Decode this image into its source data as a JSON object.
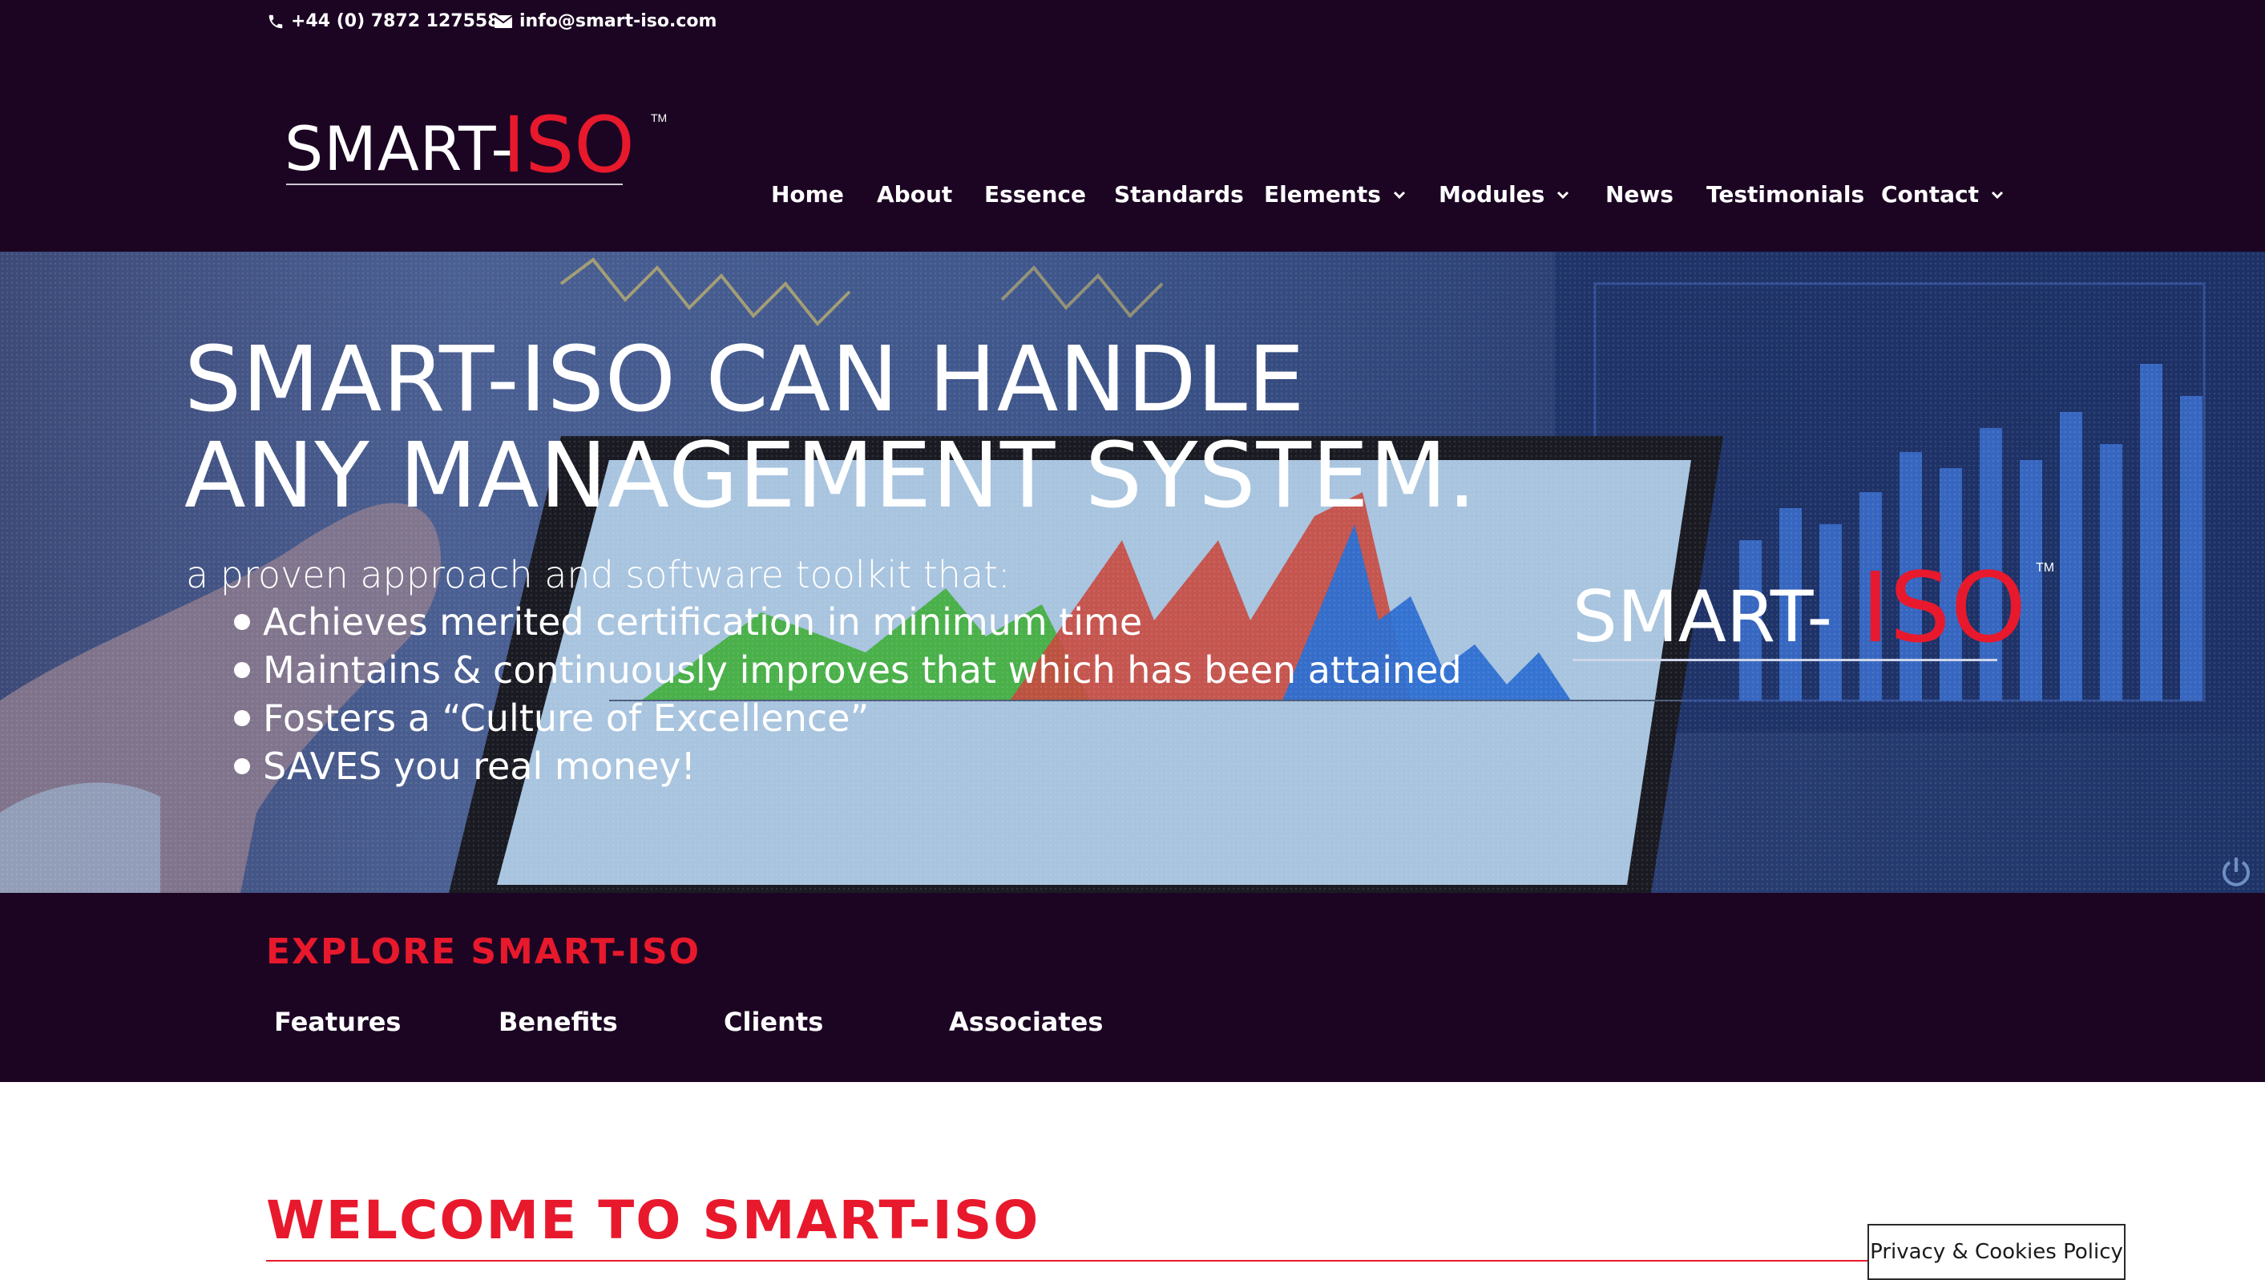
{
  "topbar": {
    "phone": "+44 (0) 7872 127558",
    "email": "info@smart-iso.com",
    "phone_icon": "phone-icon",
    "email_icon": "envelope-icon"
  },
  "logo": {
    "part1": "SMART-",
    "part2": "ISO",
    "tm": "TM"
  },
  "nav": {
    "items": [
      {
        "label": "Home",
        "dropdown": false
      },
      {
        "label": "About",
        "dropdown": false
      },
      {
        "label": "Essence",
        "dropdown": false
      },
      {
        "label": "Standards",
        "dropdown": false
      },
      {
        "label": "Elements",
        "dropdown": true
      },
      {
        "label": "Modules",
        "dropdown": true
      },
      {
        "label": "News",
        "dropdown": false
      },
      {
        "label": "Testimonials",
        "dropdown": false
      },
      {
        "label": "Contact",
        "dropdown": true
      }
    ]
  },
  "hero": {
    "title_line1": "SMART-ISO CAN HANDLE",
    "title_line2": "ANY MANAGEMENT SYSTEM.",
    "subtitle": "a proven approach and software toolkit that:",
    "bullets": [
      "Achieves merited certification in minimum time",
      "Maintains & continuously improves that which has been attained",
      "Fosters a “Culture of Excellence”",
      "SAVES you real money!"
    ],
    "power_icon": "power-icon"
  },
  "explore": {
    "title": "EXPLORE SMART-ISO",
    "links": [
      "Features",
      "Benefits",
      "Clients",
      "Associates"
    ]
  },
  "welcome": {
    "title": "WELCOME TO SMART-ISO"
  },
  "privacy": {
    "label": "Privacy & Cookies Policy"
  },
  "colors": {
    "dark_purple": "#1c0523",
    "brand_red": "#e8192c",
    "white": "#ffffff"
  }
}
